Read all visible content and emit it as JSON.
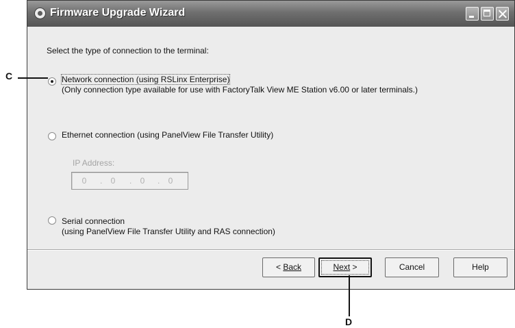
{
  "window": {
    "title": "Firmware Upgrade Wizard"
  },
  "prompt": "Select the type of connection to the terminal:",
  "options": [
    {
      "label": "Network connection (using RSLinx Enterprise)",
      "sublabel": "(Only connection type available for use with FactoryTalk View ME Station v6.00 or later terminals.)",
      "selected": true
    },
    {
      "label": "Ethernet connection (using PanelView File Transfer Utility)",
      "selected": false
    },
    {
      "label": "Serial connection",
      "sublabel": "(using PanelView File Transfer Utility and RAS connection)",
      "selected": false
    }
  ],
  "ip": {
    "label": "IP Address:",
    "octets": [
      "0",
      "0",
      "0",
      "0"
    ]
  },
  "buttons": {
    "back": "Back",
    "back_prefix": "< ",
    "next": "Next",
    "next_suffix": " >",
    "cancel": "Cancel",
    "help": "Help"
  },
  "callouts": {
    "c": "C",
    "d": "D"
  }
}
